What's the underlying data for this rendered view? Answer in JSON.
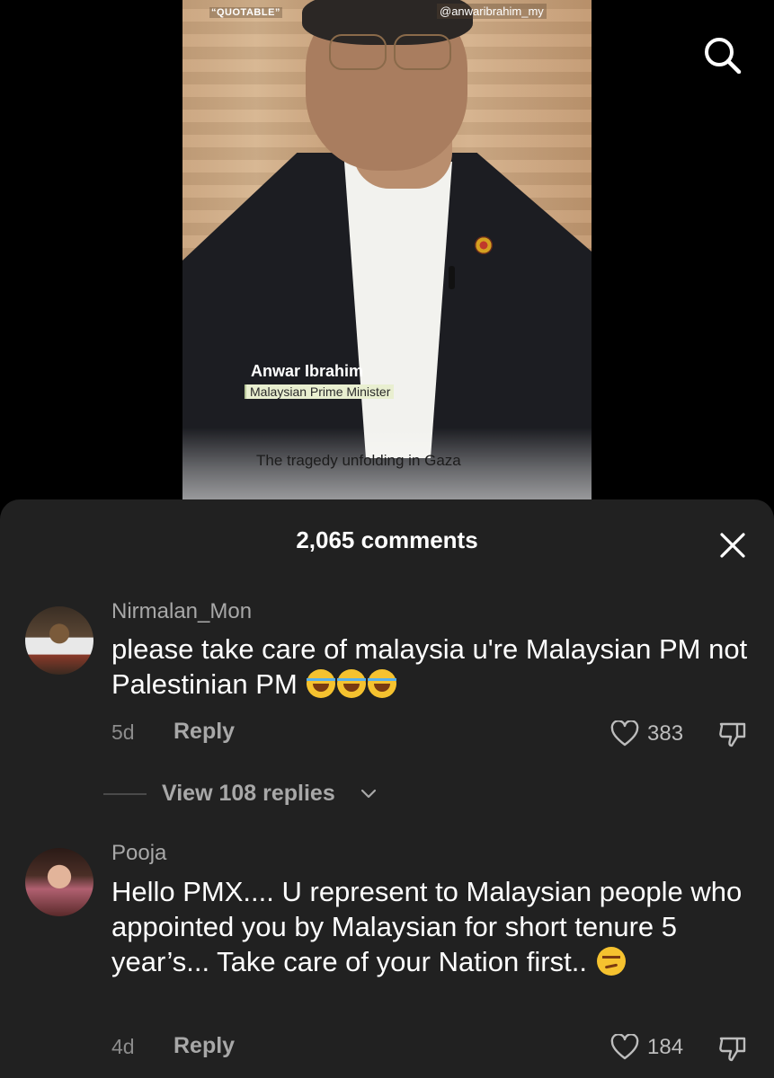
{
  "video": {
    "overlay_tag": "“QUOTABLE”",
    "handle": "@anwaribrahim_my",
    "speaker_name": "Anwar Ibrahim",
    "speaker_role": "Malaysian Prime Minister",
    "subtitle": "The tragedy unfolding in Gaza",
    "search_icon": "search-icon"
  },
  "comments_sheet": {
    "title": "2,065 comments",
    "close_icon": "close-icon",
    "comments": [
      {
        "username": "Nirmalan_Mon",
        "text": "please take care of malaysia u're Malaysian PM not Palestinian PM",
        "emojis": [
          "rolling-on-floor-laughing",
          "rolling-on-floor-laughing",
          "rolling-on-floor-laughing"
        ],
        "time": "5d",
        "reply_label": "Reply",
        "likes": "383",
        "view_replies": "View 108 replies"
      },
      {
        "username": "Pooja",
        "text": "Hello PMX.... U represent to Malaysian people who appointed you by Malaysian for short tenure 5 year’s... Take care of your Nation first..",
        "emojis": [
          "smirking-face"
        ],
        "time": "4d",
        "reply_label": "Reply",
        "likes": "184"
      }
    ]
  },
  "colors": {
    "background": "#000000",
    "sheet": "#212121",
    "secondary_text": "#a8a8a8"
  }
}
